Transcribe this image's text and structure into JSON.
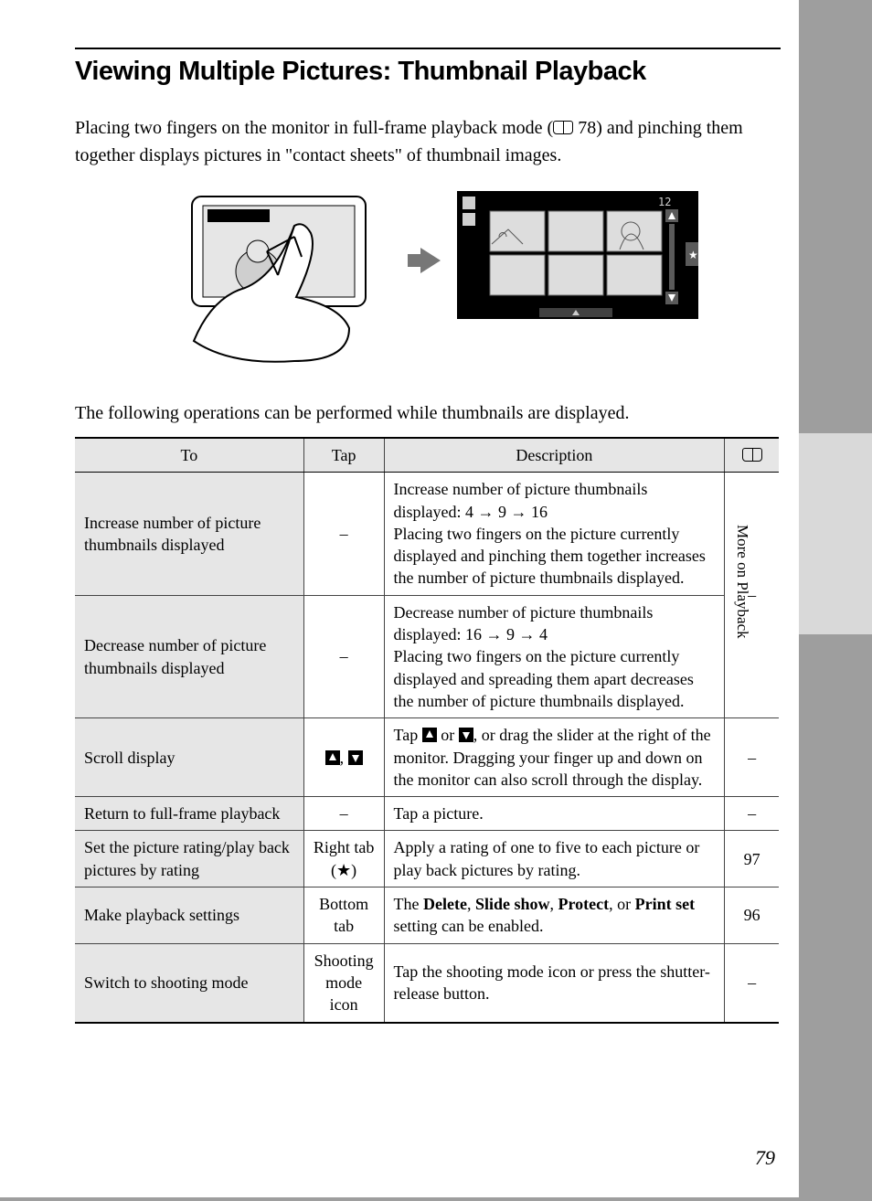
{
  "page": {
    "title": "Viewing Multiple Pictures: Thumbnail Playback",
    "intro_pre": "Placing two fingers on the monitor in full-frame playback mode (",
    "intro_pageref": " 78) and pinching them together displays pictures in \"contact sheets\" of thumbnail images.",
    "intro2": "The following operations can be performed while thumbnails are displayed.",
    "side_tab": "More on Playback",
    "page_number": "79",
    "illustration": {
      "left_alt": "Hand pinching camera LCD showing a single photo",
      "right_alt": "Thumbnail playback screen with 6 photos, slider and icons",
      "right_counter": "12"
    }
  },
  "table": {
    "headers": {
      "c1": "To",
      "c2": "Tap",
      "c3": "Description",
      "c4_icon": "book"
    },
    "rows": [
      {
        "to": "Increase number of picture thumbnails displayed",
        "tap": "–",
        "desc": "Increase number of picture thumbnails displayed: 4 → 9 → 16\nPlacing two fingers on the picture currently displayed and pinching them together increases the number of picture thumbnails displayed.",
        "ref": "–",
        "ref_rowspan": 2
      },
      {
        "to": "Decrease number of picture thumbnails displayed",
        "tap": "–",
        "desc": "Decrease number of picture thumbnails displayed: 16 → 9 → 4\nPlacing two fingers on the picture currently displayed and spreading them apart decreases the number of picture thumbnails displayed."
      },
      {
        "to": "Scroll display",
        "tap_icons": "up-down",
        "desc_pre": "Tap ",
        "desc_mid": " or ",
        "desc_post": ", or drag the slider at the right of the monitor. Dragging your finger up and down on the monitor can also scroll through the display.",
        "ref": "–"
      },
      {
        "to": "Return to full-frame playback",
        "tap": "–",
        "desc": "Tap a picture.",
        "ref": "–"
      },
      {
        "to": "Set the picture rating/play back pictures by rating",
        "tap": "Right tab (★)",
        "desc": "Apply a rating of one to five to each picture or play back pictures by rating.",
        "ref": "97"
      },
      {
        "to": "Make playback settings",
        "tap": "Bottom tab",
        "desc_parts": [
          "The ",
          "Delete",
          ", ",
          "Slide show",
          ", ",
          "Protect",
          ", or ",
          "Print set",
          " setting can be enabled."
        ],
        "ref": "96"
      },
      {
        "to": "Switch to shooting mode",
        "tap": "Shooting mode icon",
        "desc": "Tap the shooting mode icon or press the shutter-release button.",
        "ref": "–"
      }
    ]
  }
}
